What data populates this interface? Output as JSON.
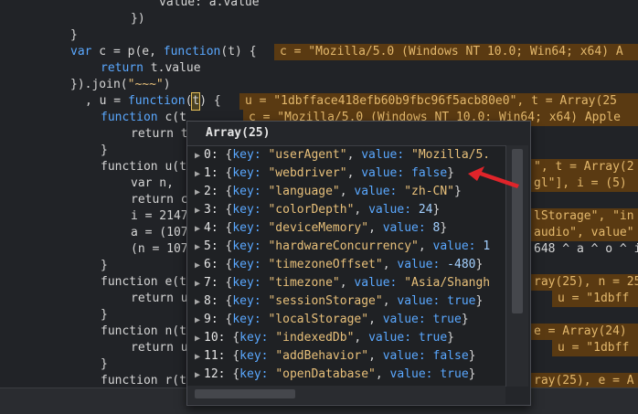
{
  "code": {
    "l0": "value: a.value",
    "l1": "})",
    "l2": "}",
    "l3a": "var",
    "l3b": " c = p(e, ",
    "l3c": "function",
    "l3d": "(t) {",
    "l3eval": "c = \"Mozilla/5.0 (Windows NT 10.0; Win64; x64) A",
    "l4a": "return",
    "l4b": " t.value",
    "l5a": "}).join(",
    "l5b": "\"~~~\"",
    "l5c": ")",
    "l6a": ", u = ",
    "l6b": "function",
    "l6c": "(",
    "l6d": "t",
    "l6e": ") {",
    "l6eval": "u = \"1dbfface418efb60b9fbc96f5acb80e0\", t = Array(25",
    "l7": "function c(t",
    "l7eval": "c = \"Mozilla/5.0 (Windows NT 10.0; Win64; x64) Apple",
    "l8": "return t",
    "l9": "}",
    "l10": "function u(t",
    "l10r": "\", t = Array(2",
    "l11": "var n,",
    "l11r": "gl\"], i = (5)",
    "l12": "return c",
    "l13": "i = 2147",
    "l13r": "lStorage\", \"in",
    "l14": "a = (107",
    "l14r": "audio\", value\"",
    "l15": "(n = 107",
    "l15r": "648 ^ a ^ o ^ i",
    "l16": "}",
    "l17": "function e(t",
    "l17r": "ray(25), n = 25",
    "l18": "return u",
    "l18r": "u = \"1dbff",
    "l19": "}",
    "l20": "function n(t",
    "l20r": "e = Array(24)",
    "l21": "return u",
    "l21r": "u = \"1dbff",
    "l22": "}",
    "l23": "function r(t",
    "l23r": "ray(25), e = A"
  },
  "popup": {
    "title": "Array(25)",
    "rows": [
      {
        "idx": "0:",
        "key": "\"userAgent\"",
        "vtype": "str",
        "value": "\"Mozilla/5."
      },
      {
        "idx": "1:",
        "key": "\"webdriver\"",
        "vtype": "bool",
        "value": "false",
        "tail": "}"
      },
      {
        "idx": "2:",
        "key": "\"language\"",
        "vtype": "str",
        "value": "\"zh-CN\"",
        "tail": "}"
      },
      {
        "idx": "3:",
        "key": "\"colorDepth\"",
        "vtype": "num",
        "value": "24",
        "tail": "}"
      },
      {
        "idx": "4:",
        "key": "\"deviceMemory\"",
        "vtype": "num",
        "value": "8",
        "tail": "}"
      },
      {
        "idx": "5:",
        "key": "\"hardwareConcurrency\"",
        "vtype": "num",
        "value": "1"
      },
      {
        "idx": "6:",
        "key": "\"timezoneOffset\"",
        "vtype": "num",
        "value": "-480",
        "tail": "}"
      },
      {
        "idx": "7:",
        "key": "\"timezone\"",
        "vtype": "str",
        "value": "\"Asia/Shangh"
      },
      {
        "idx": "8:",
        "key": "\"sessionStorage\"",
        "vtype": "bool",
        "value": "true",
        "tail": "}"
      },
      {
        "idx": "9:",
        "key": "\"localStorage\"",
        "vtype": "bool",
        "value": "true",
        "tail": "}"
      },
      {
        "idx": "10:",
        "key": "\"indexedDb\"",
        "vtype": "bool",
        "value": "true",
        "tail": "}"
      },
      {
        "idx": "11:",
        "key": "\"addBehavior\"",
        "vtype": "bool",
        "value": "false",
        "tail": "}"
      },
      {
        "idx": "12:",
        "key": "\"openDatabase\"",
        "vtype": "bool",
        "value": "true",
        "tail": "}"
      }
    ],
    "labels": {
      "open": "{",
      "keyLabel": "key:",
      "sep": ", ",
      "valueLabel": "value:",
      "space": " "
    }
  },
  "colors": {
    "annotation_arrow": "#e0242a",
    "inline_eval_bg": "#5a3a12"
  }
}
